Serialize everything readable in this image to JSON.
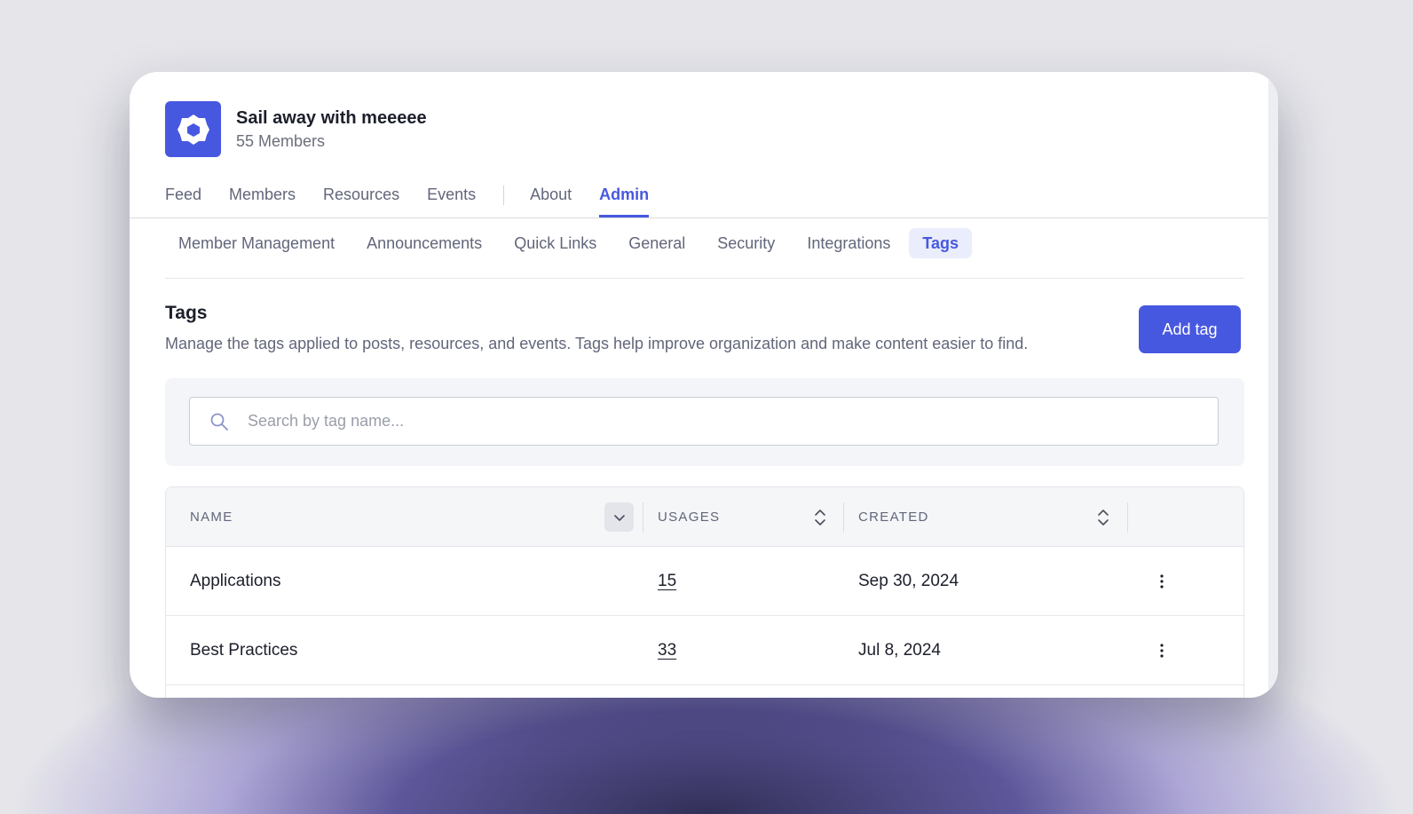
{
  "group": {
    "name": "Sail away with meeeee",
    "member_count": "55 Members",
    "logo_icon": "gear-logo-icon",
    "accent_color": "#4758e0"
  },
  "main_nav": {
    "items": [
      {
        "label": "Feed",
        "active": false
      },
      {
        "label": "Members",
        "active": false
      },
      {
        "label": "Resources",
        "active": false
      },
      {
        "label": "Events",
        "active": false
      },
      {
        "label": "About",
        "active": false
      },
      {
        "label": "Admin",
        "active": true
      }
    ]
  },
  "sub_nav": {
    "items": [
      {
        "label": "Member Management",
        "active": false
      },
      {
        "label": "Announcements",
        "active": false
      },
      {
        "label": "Quick Links",
        "active": false
      },
      {
        "label": "General",
        "active": false
      },
      {
        "label": "Security",
        "active": false
      },
      {
        "label": "Integrations",
        "active": false
      },
      {
        "label": "Tags",
        "active": true
      }
    ]
  },
  "section": {
    "title": "Tags",
    "description": "Manage the tags applied to posts, resources, and events. Tags help improve organization and make content easier to find.",
    "add_button_label": "Add tag"
  },
  "search": {
    "placeholder": "Search by tag name...",
    "value": "",
    "icon": "search-icon"
  },
  "table": {
    "columns": [
      {
        "label": "NAME",
        "sort": "descending"
      },
      {
        "label": "USAGES",
        "sort": "none"
      },
      {
        "label": "CREATED",
        "sort": "none"
      }
    ],
    "rows": [
      {
        "name": "Applications",
        "usages": "15",
        "created": "Sep 30, 2024"
      },
      {
        "name": "Best Practices",
        "usages": "33",
        "created": "Jul 8, 2024"
      }
    ]
  }
}
